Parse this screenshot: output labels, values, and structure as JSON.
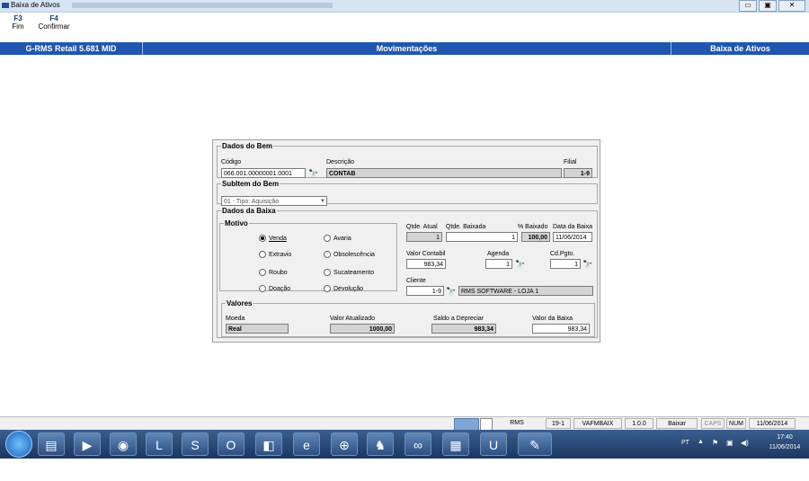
{
  "window": {
    "title": "Baixa de Ativos"
  },
  "fkeys": [
    {
      "key": "F3",
      "label": "Fim"
    },
    {
      "key": "F4",
      "label": "Confirmar"
    }
  ],
  "header": {
    "app": "G-RMS Retail 5.681 MID",
    "section": "Movimentações",
    "screen": "Baixa de Ativos"
  },
  "dados_bem": {
    "legend": "Dados do Bem",
    "codigo_label": "Código",
    "codigo": "066.001.00000001.0001",
    "descricao_label": "Descrição",
    "descricao": "CONTAB",
    "filial_label": "Filial",
    "filial": "1-9"
  },
  "subitem": {
    "legend": "SubItem do Bem",
    "value": "01 - Tipo: Aquisição"
  },
  "dados_baixa": {
    "legend": "Dados da Baixa",
    "motivo_legend": "Motivo",
    "motivos": [
      {
        "label": "Venda",
        "checked": true
      },
      {
        "label": "Avaria",
        "checked": false
      },
      {
        "label": "Extravio",
        "checked": false
      },
      {
        "label": "Obsolescência",
        "checked": false
      },
      {
        "label": "Roubo",
        "checked": false
      },
      {
        "label": "Sucateamento",
        "checked": false
      },
      {
        "label": "Doação",
        "checked": false
      },
      {
        "label": "Devolução",
        "checked": false
      }
    ],
    "qtde_atual_label": "Qtde. Atual",
    "qtde_atual": "1",
    "qtde_baixada_label": "Qtde. Baixada",
    "qtde_baixada": "1",
    "pct_baixado_label": "% Baixado",
    "pct_baixado": "100,00",
    "data_baixa_label": "Data da Baixa",
    "data_baixa": "11/06/2014",
    "valor_contabil_label": "Valor Contabil",
    "valor_contabil": "983,34",
    "agenda_label": "Agenda",
    "agenda": "1",
    "cdpgto_label": "Cd.Pgto.",
    "cdpgto": "1",
    "cliente_label": "Cliente",
    "cliente_cod": "1-9",
    "cliente_nome": "RMS SOFTWARE - LOJA 1"
  },
  "valores": {
    "legend": "Valores",
    "moeda_label": "Moeda",
    "moeda": "Real",
    "valor_atualizado_label": "Valor Atualizado",
    "valor_atualizado": "1000,00",
    "saldo_label": "Saldo a Depreciar",
    "saldo": "983,34",
    "valor_baixa_label": "Valor da Baixa",
    "valor_baixa": "983,34"
  },
  "statusbar": {
    "app": "RMS",
    "filial": "19-1",
    "program": "VAFMBAIX",
    "version": "1.0.0",
    "mode": "Baixar",
    "caps": "CAPS",
    "num": "NUM",
    "date": "11/06/2014"
  },
  "tray": {
    "lang": "PT",
    "time": "17:40",
    "date": "11/06/2014"
  }
}
